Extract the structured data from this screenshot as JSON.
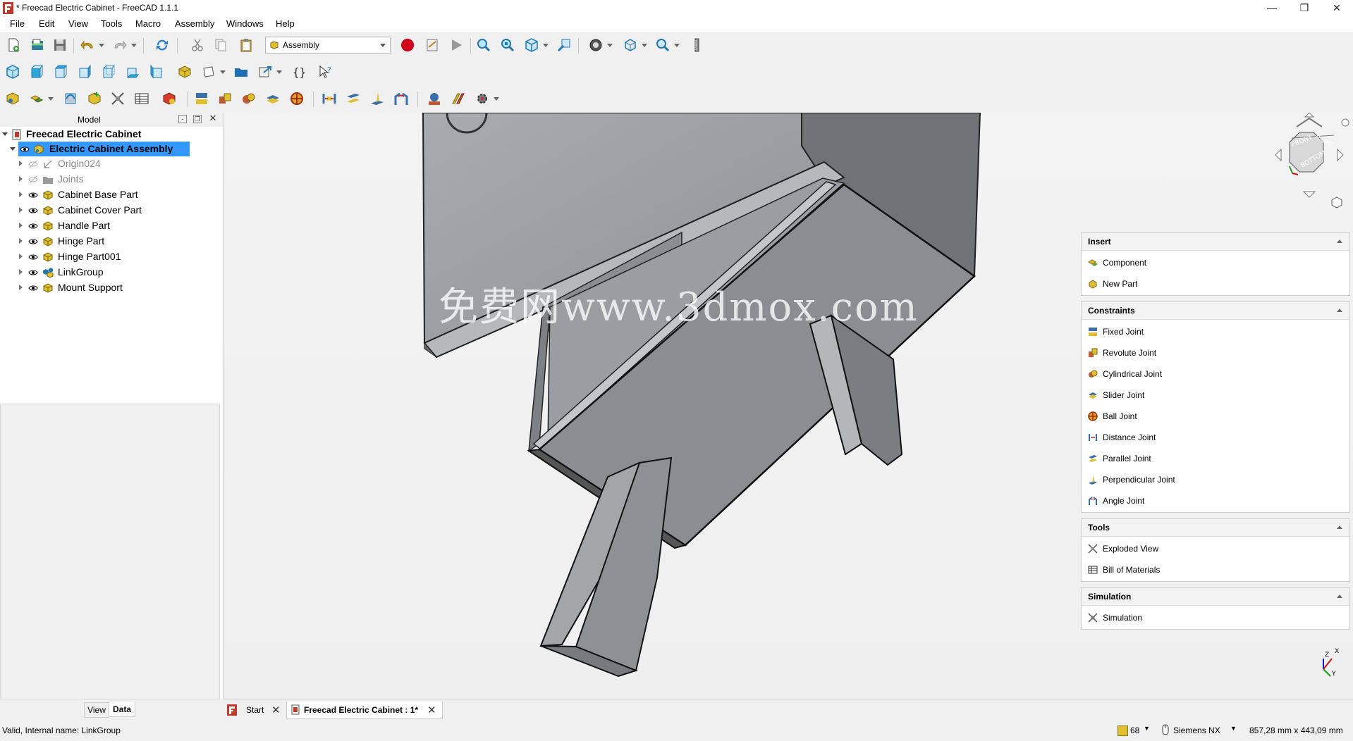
{
  "window": {
    "title": "* Freecad Electric Cabinet - FreeCAD 1.1.1",
    "controls": [
      "minimize",
      "restore",
      "close"
    ]
  },
  "menu": [
    "File",
    "Edit",
    "View",
    "Tools",
    "Macro",
    "Assembly",
    "Windows",
    "Help"
  ],
  "workbench": {
    "selected": "Assembly"
  },
  "model_panel": {
    "title": "Model",
    "root": "Freecad Electric Cabinet",
    "selected": "Electric Cabinet Assembly",
    "children": [
      {
        "label": "Origin024",
        "muted": true,
        "icon": "origin-icon"
      },
      {
        "label": "Joints",
        "muted": true,
        "icon": "folder-icon"
      },
      {
        "label": "Cabinet Base Part",
        "muted": false,
        "icon": "part-icon"
      },
      {
        "label": "Cabinet Cover Part",
        "muted": false,
        "icon": "part-icon"
      },
      {
        "label": "Handle Part",
        "muted": false,
        "icon": "part-icon"
      },
      {
        "label": "Hinge Part",
        "muted": false,
        "icon": "part-icon"
      },
      {
        "label": "Hinge Part001",
        "muted": false,
        "icon": "part-icon"
      },
      {
        "label": "LinkGroup",
        "muted": false,
        "icon": "linkgroup-icon"
      },
      {
        "label": "Mount Support",
        "muted": false,
        "icon": "part-icon"
      }
    ],
    "tabs": [
      "View",
      "Data"
    ],
    "active_tab": "Data"
  },
  "task_panel": {
    "sections": [
      {
        "title": "Insert",
        "items": [
          {
            "label": "Component",
            "icon": "component-icon"
          },
          {
            "label": "New Part",
            "icon": "new-part-icon"
          }
        ]
      },
      {
        "title": "Constraints",
        "items": [
          {
            "label": "Fixed Joint",
            "icon": "fixed-joint-icon"
          },
          {
            "label": "Revolute Joint",
            "icon": "revolute-joint-icon"
          },
          {
            "label": "Cylindrical Joint",
            "icon": "cylindrical-joint-icon"
          },
          {
            "label": "Slider Joint",
            "icon": "slider-joint-icon"
          },
          {
            "label": "Ball Joint",
            "icon": "ball-joint-icon"
          },
          {
            "label": "Distance Joint",
            "icon": "distance-joint-icon"
          },
          {
            "label": "Parallel Joint",
            "icon": "parallel-joint-icon"
          },
          {
            "label": "Perpendicular Joint",
            "icon": "perpendicular-joint-icon"
          },
          {
            "label": "Angle Joint",
            "icon": "angle-joint-icon"
          }
        ]
      },
      {
        "title": "Tools",
        "items": [
          {
            "label": "Exploded View",
            "icon": "exploded-view-icon"
          },
          {
            "label": "Bill of Materials",
            "icon": "bom-icon"
          }
        ]
      },
      {
        "title": "Simulation",
        "items": [
          {
            "label": "Simulation",
            "icon": "simulation-icon"
          }
        ]
      }
    ]
  },
  "view3d": {
    "watermark": "免费网www.3dmox.com",
    "navcube_faces": [
      "FRONT",
      "RIGHT",
      "BOTTOM"
    ],
    "axis_labels": [
      "Z",
      "X",
      "Y"
    ]
  },
  "doc_tabs": [
    {
      "label": "Start",
      "active": false
    },
    {
      "label": "Freecad Electric Cabinet : 1*",
      "active": true
    }
  ],
  "status": {
    "message": "Valid, Internal name: LinkGroup",
    "render_count": "68",
    "nav_style": "Siemens NX",
    "dimensions": "857,28 mm x 443,09 mm"
  },
  "colors": {
    "selection": "#3399ff",
    "part_gray": "#8c8f93",
    "record_red": "#d0021b",
    "accent_blue": "#1f78b4",
    "part_yellow": "#e0c030"
  }
}
